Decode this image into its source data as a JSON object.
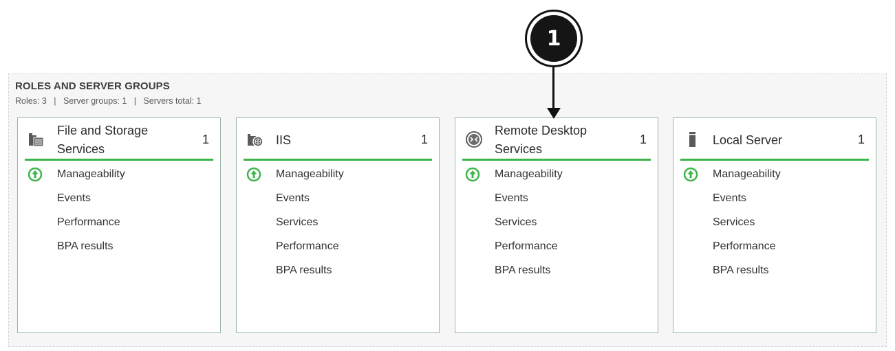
{
  "section": {
    "title": "ROLES AND SERVER GROUPS",
    "summary": "Roles: 3   |   Server groups: 1   |   Servers total: 1"
  },
  "callout": {
    "label": "1"
  },
  "status_color": "#3cb548",
  "tiles": [
    {
      "title_line1": "File and Storage",
      "title_line2": "Services",
      "count": "1",
      "icon": "file-storage-icon",
      "rows": [
        "Manageability",
        "Events",
        "Performance",
        "BPA results"
      ]
    },
    {
      "title_line1": "IIS",
      "title_line2": "",
      "count": "1",
      "icon": "iis-icon",
      "rows": [
        "Manageability",
        "Events",
        "Services",
        "Performance",
        "BPA results"
      ]
    },
    {
      "title_line1": "Remote Desktop",
      "title_line2": "Services",
      "count": "1",
      "icon": "remote-desktop-icon",
      "rows": [
        "Manageability",
        "Events",
        "Services",
        "Performance",
        "BPA results"
      ]
    },
    {
      "title_line1": "Local Server",
      "title_line2": "",
      "count": "1",
      "icon": "server-icon",
      "rows": [
        "Manageability",
        "Events",
        "Services",
        "Performance",
        "BPA results"
      ]
    }
  ]
}
